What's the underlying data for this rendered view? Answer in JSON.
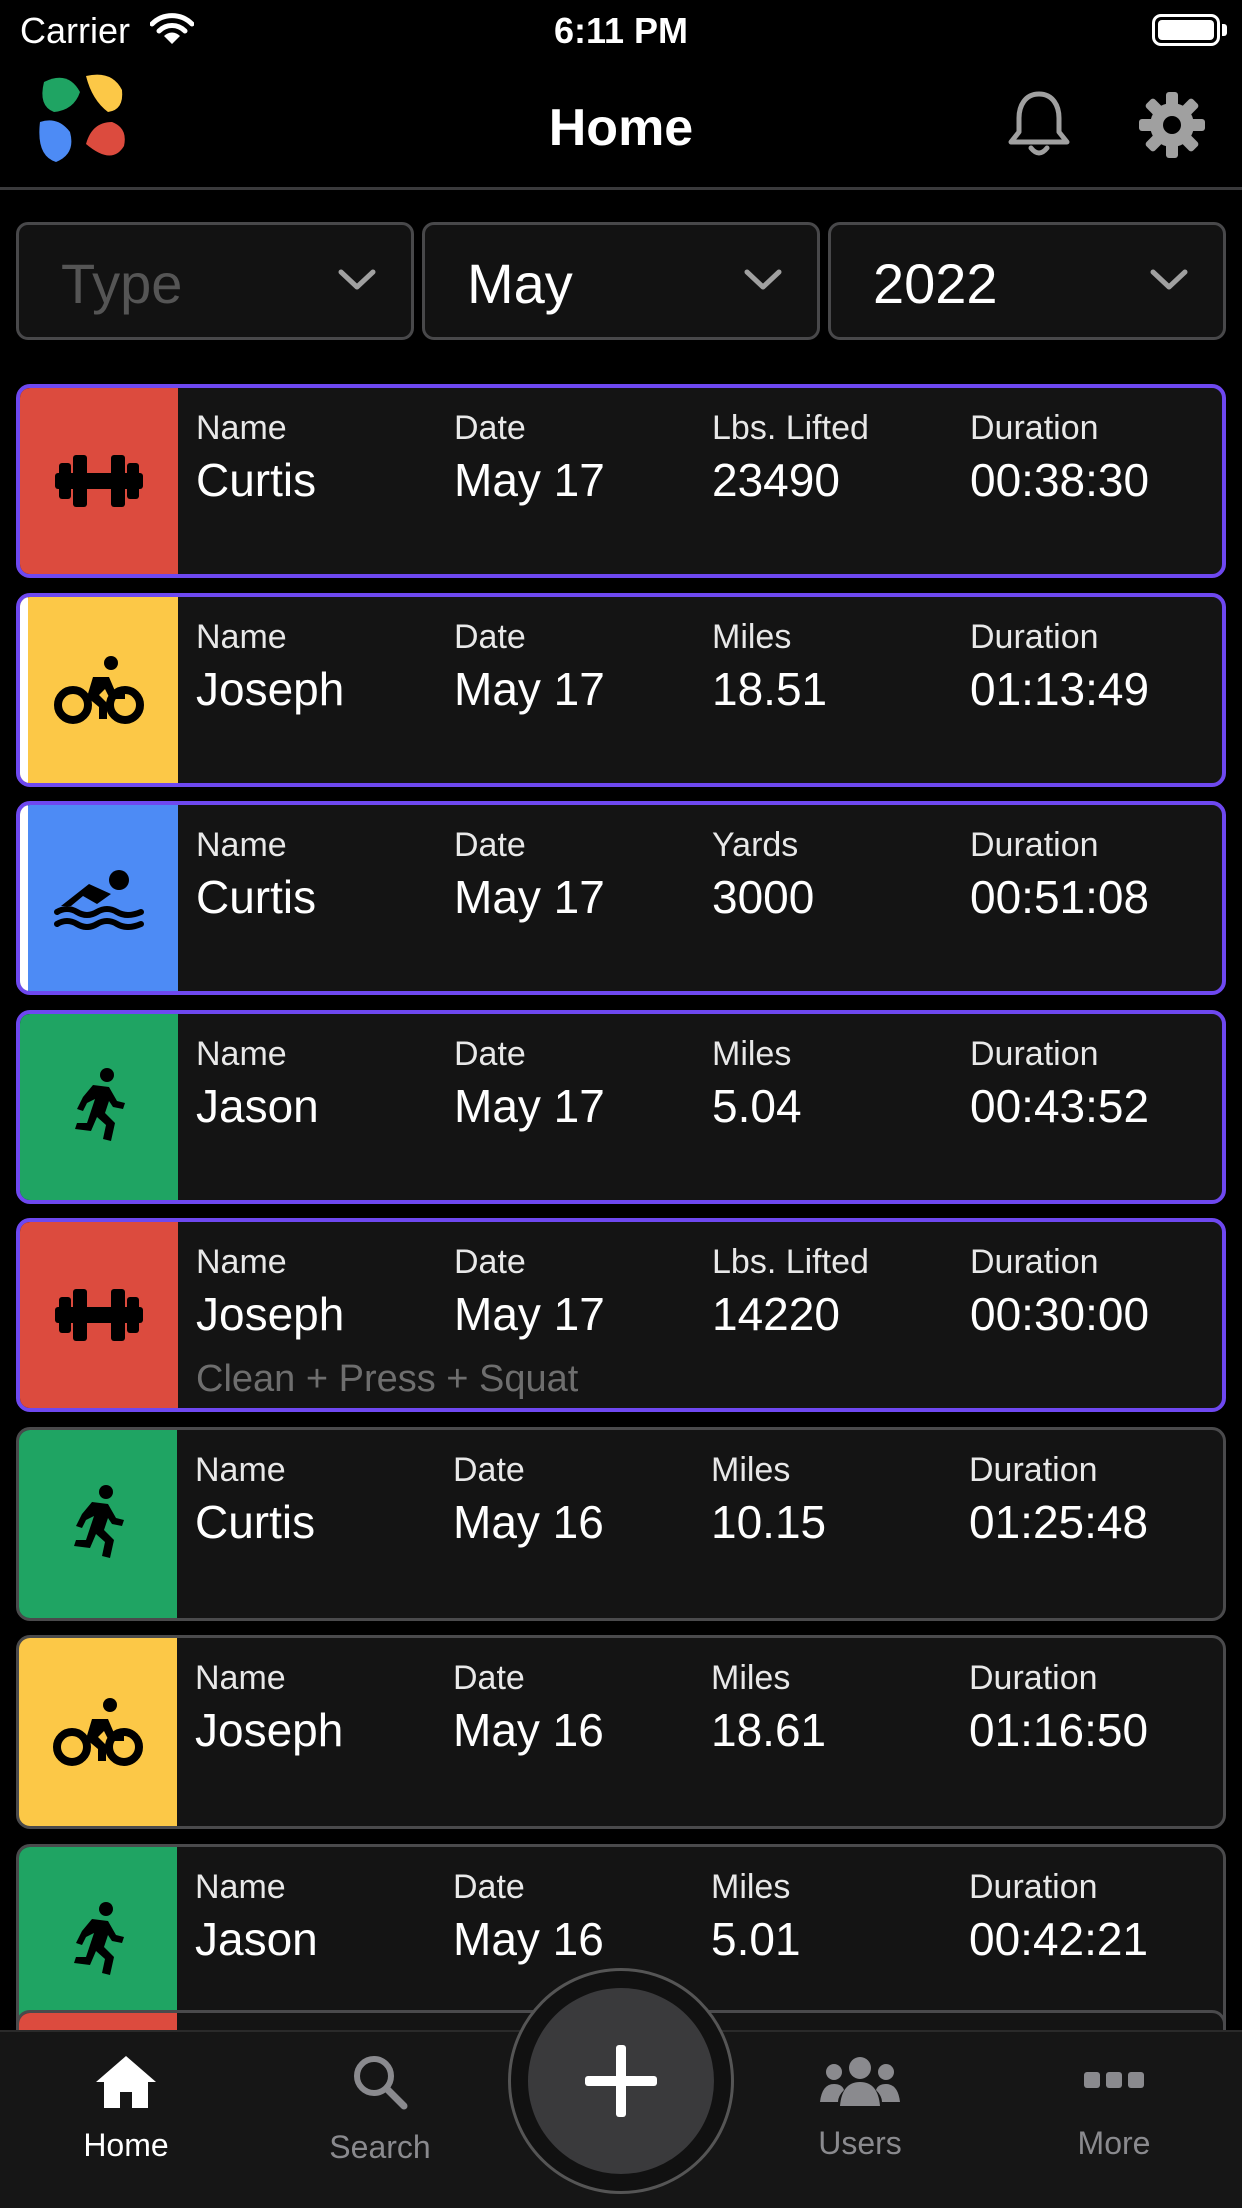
{
  "status_bar": {
    "carrier": "Carrier",
    "time": "6:11 PM"
  },
  "header": {
    "title": "Home"
  },
  "filters": {
    "type": {
      "placeholder": "Type",
      "value": ""
    },
    "month": {
      "value": "May"
    },
    "year": {
      "value": "2022"
    }
  },
  "activities": [
    {
      "type": "weightlifting",
      "color": "#dc4b3e",
      "selected": true,
      "labels": [
        "Name",
        "Date",
        "Lbs. Lifted",
        "Duration"
      ],
      "values": [
        "Curtis",
        "May 17",
        "23490",
        "00:38:30"
      ],
      "note": ""
    },
    {
      "type": "cycling",
      "color": "#fcc847",
      "selected": true,
      "labels": [
        "Name",
        "Date",
        "Miles",
        "Duration"
      ],
      "values": [
        "Joseph",
        "May 17",
        "18.51",
        "01:13:49"
      ],
      "note": ""
    },
    {
      "type": "swimming",
      "color": "#4d8bf5",
      "selected": true,
      "labels": [
        "Name",
        "Date",
        "Yards",
        "Duration"
      ],
      "values": [
        "Curtis",
        "May 17",
        "3000",
        "00:51:08"
      ],
      "note": ""
    },
    {
      "type": "running",
      "color": "#1fa463",
      "selected": true,
      "labels": [
        "Name",
        "Date",
        "Miles",
        "Duration"
      ],
      "values": [
        "Jason",
        "May 17",
        "5.04",
        "00:43:52"
      ],
      "note": ""
    },
    {
      "type": "weightlifting",
      "color": "#dc4b3e",
      "selected": true,
      "labels": [
        "Name",
        "Date",
        "Lbs. Lifted",
        "Duration"
      ],
      "values": [
        "Joseph",
        "May 17",
        "14220",
        "00:30:00"
      ],
      "note": "Clean + Press + Squat"
    },
    {
      "type": "running",
      "color": "#1fa463",
      "selected": false,
      "labels": [
        "Name",
        "Date",
        "Miles",
        "Duration"
      ],
      "values": [
        "Curtis",
        "May 16",
        "10.15",
        "01:25:48"
      ],
      "note": ""
    },
    {
      "type": "cycling",
      "color": "#fcc847",
      "selected": false,
      "labels": [
        "Name",
        "Date",
        "Miles",
        "Duration"
      ],
      "values": [
        "Joseph",
        "May 16",
        "18.61",
        "01:16:50"
      ],
      "note": ""
    },
    {
      "type": "running",
      "color": "#1fa463",
      "selected": false,
      "labels": [
        "Name",
        "Date",
        "Miles",
        "Duration"
      ],
      "values": [
        "Jason",
        "May 16",
        "5.01",
        "00:42:21"
      ],
      "note": ""
    }
  ],
  "tab_bar": {
    "home": "Home",
    "search": "Search",
    "users": "Users",
    "more": "More"
  },
  "colors": {
    "selected_border": "#6e48f0",
    "weightlifting": "#dc4b3e",
    "cycling": "#fcc847",
    "swimming": "#4d8bf5",
    "running": "#1fa463"
  }
}
